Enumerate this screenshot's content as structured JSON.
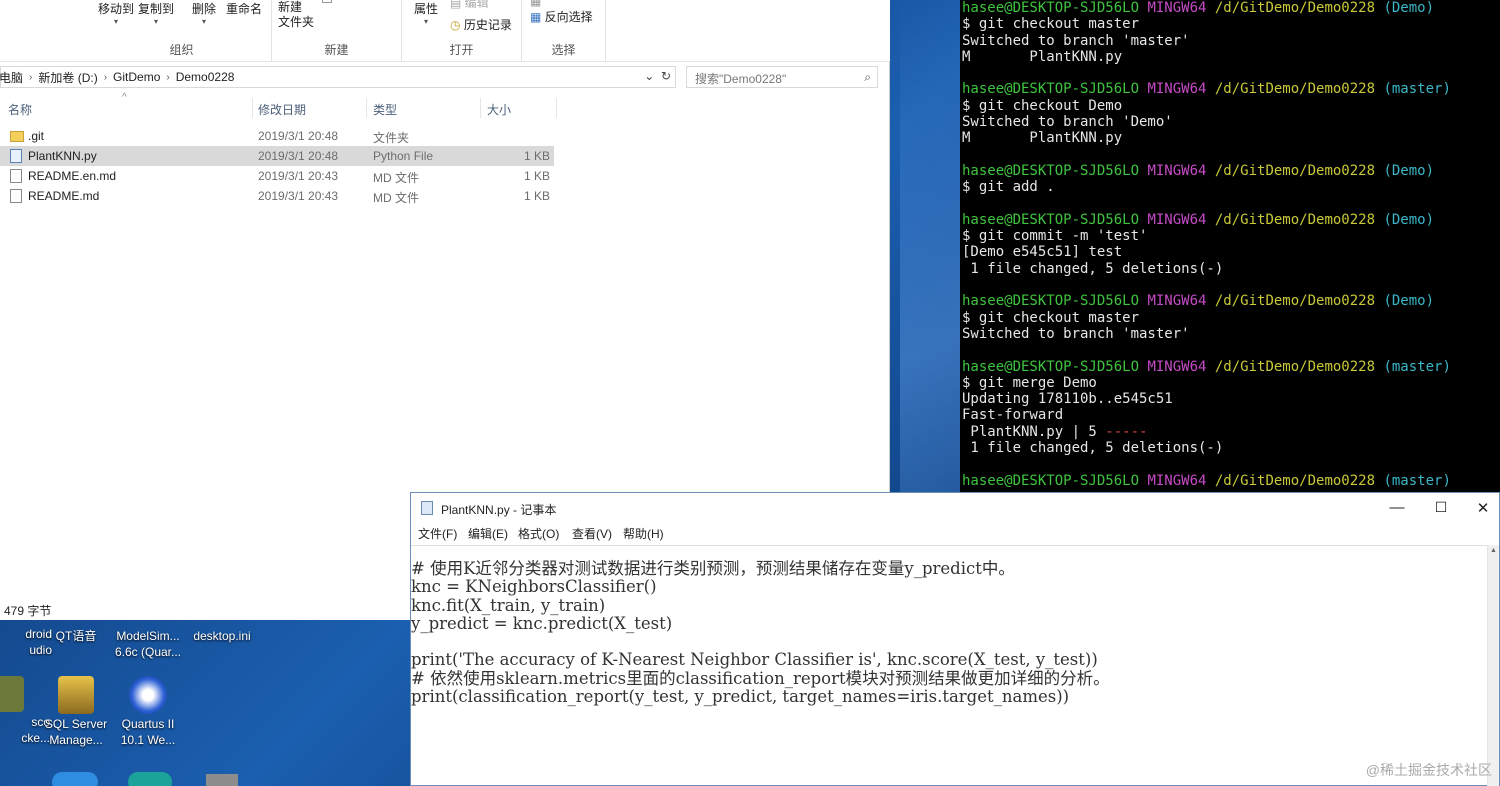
{
  "explorer": {
    "ribbon": {
      "groups": [
        {
          "label": "组织",
          "buttons": [
            "移动到",
            "复制到",
            "删除",
            "重命名"
          ]
        },
        {
          "label": "新建",
          "buttons": [
            "新建",
            "文件夹"
          ]
        },
        {
          "label": "打开",
          "buttons": [
            "属性",
            "编辑",
            "历史记录"
          ]
        },
        {
          "label": "选择",
          "buttons": [
            "反向选择"
          ]
        }
      ]
    },
    "address": {
      "segments": [
        "电脑",
        "新加卷 (D:)",
        "GitDemo",
        "Demo0228"
      ],
      "search_placeholder": "搜索\"Demo0228\""
    },
    "columns": [
      "名称",
      "修改日期",
      "类型",
      "大小"
    ],
    "files": [
      {
        "name": ".git",
        "date": "2019/3/1 20:48",
        "type": "文件夹",
        "size": "",
        "icon": "folder-icon",
        "selected": false
      },
      {
        "name": "PlantKNN.py",
        "date": "2019/3/1 20:48",
        "type": "Python File",
        "size": "1 KB",
        "icon": "python-file-icon",
        "selected": true
      },
      {
        "name": "README.en.md",
        "date": "2019/3/1 20:43",
        "type": "MD 文件",
        "size": "1 KB",
        "icon": "file-icon",
        "selected": false
      },
      {
        "name": "README.md",
        "date": "2019/3/1 20:43",
        "type": "MD 文件",
        "size": "1 KB",
        "icon": "file-icon",
        "selected": false
      }
    ],
    "status": "479 字节"
  },
  "desktop_icons": [
    {
      "label": "droid\nudio",
      "name": "android-studio-icon"
    },
    {
      "label": "QT语音",
      "name": "qt-voice-icon"
    },
    {
      "label": "ModelSim...\n6.6c (Quar...",
      "name": "modelsim-icon"
    },
    {
      "label": "desktop.ini",
      "name": "desktop-ini-icon"
    },
    {
      "label": "sco\ncke...",
      "name": "cisco-packet-icon"
    },
    {
      "label": "SQL Server\nManage...",
      "name": "sql-server-icon"
    },
    {
      "label": "Quartus II\n10.1 We...",
      "name": "quartus-icon"
    }
  ],
  "terminal": {
    "lines": [
      [
        {
          "t": "hasee@DESKTOP-SJD56LO ",
          "c": "green"
        },
        {
          "t": "MINGW64 ",
          "c": "purple"
        },
        {
          "t": "/d/GitDemo/Demo0228 ",
          "c": "yellow"
        },
        {
          "t": "(Demo)",
          "c": "cyan"
        }
      ],
      [
        {
          "t": "$ git checkout master",
          "c": "white"
        }
      ],
      [
        {
          "t": "Switched to branch 'master'",
          "c": "white"
        }
      ],
      [
        {
          "t": "M       PlantKNN.py",
          "c": "white"
        }
      ],
      [],
      [
        {
          "t": "hasee@DESKTOP-SJD56LO ",
          "c": "green"
        },
        {
          "t": "MINGW64 ",
          "c": "purple"
        },
        {
          "t": "/d/GitDemo/Demo0228 ",
          "c": "yellow"
        },
        {
          "t": "(master)",
          "c": "cyan"
        }
      ],
      [
        {
          "t": "$ git checkout Demo",
          "c": "white"
        }
      ],
      [
        {
          "t": "Switched to branch 'Demo'",
          "c": "white"
        }
      ],
      [
        {
          "t": "M       PlantKNN.py",
          "c": "white"
        }
      ],
      [],
      [
        {
          "t": "hasee@DESKTOP-SJD56LO ",
          "c": "green"
        },
        {
          "t": "MINGW64 ",
          "c": "purple"
        },
        {
          "t": "/d/GitDemo/Demo0228 ",
          "c": "yellow"
        },
        {
          "t": "(Demo)",
          "c": "cyan"
        }
      ],
      [
        {
          "t": "$ git add .",
          "c": "white"
        }
      ],
      [],
      [
        {
          "t": "hasee@DESKTOP-SJD56LO ",
          "c": "green"
        },
        {
          "t": "MINGW64 ",
          "c": "purple"
        },
        {
          "t": "/d/GitDemo/Demo0228 ",
          "c": "yellow"
        },
        {
          "t": "(Demo)",
          "c": "cyan"
        }
      ],
      [
        {
          "t": "$ git commit -m 'test'",
          "c": "white"
        }
      ],
      [
        {
          "t": "[Demo e545c51] test",
          "c": "white"
        }
      ],
      [
        {
          "t": " 1 file changed, 5 deletions(-)",
          "c": "white"
        }
      ],
      [],
      [
        {
          "t": "hasee@DESKTOP-SJD56LO ",
          "c": "green"
        },
        {
          "t": "MINGW64 ",
          "c": "purple"
        },
        {
          "t": "/d/GitDemo/Demo0228 ",
          "c": "yellow"
        },
        {
          "t": "(Demo)",
          "c": "cyan"
        }
      ],
      [
        {
          "t": "$ git checkout master",
          "c": "white"
        }
      ],
      [
        {
          "t": "Switched to branch 'master'",
          "c": "white"
        }
      ],
      [],
      [
        {
          "t": "hasee@DESKTOP-SJD56LO ",
          "c": "green"
        },
        {
          "t": "MINGW64 ",
          "c": "purple"
        },
        {
          "t": "/d/GitDemo/Demo0228 ",
          "c": "yellow"
        },
        {
          "t": "(master)",
          "c": "cyan"
        }
      ],
      [
        {
          "t": "$ git merge Demo",
          "c": "white"
        }
      ],
      [
        {
          "t": "Updating 178110b..e545c51",
          "c": "white"
        }
      ],
      [
        {
          "t": "Fast-forward",
          "c": "white"
        }
      ],
      [
        {
          "t": " PlantKNN.py | 5 ",
          "c": "white"
        },
        {
          "t": "-----",
          "c": "red"
        }
      ],
      [
        {
          "t": " 1 file changed, 5 deletions(-)",
          "c": "white"
        }
      ],
      [],
      [
        {
          "t": "hasee@DESKTOP-SJD56LO ",
          "c": "green"
        },
        {
          "t": "MINGW64 ",
          "c": "purple"
        },
        {
          "t": "/d/GitDemo/Demo0228 ",
          "c": "yellow"
        },
        {
          "t": "(master)",
          "c": "cyan"
        }
      ]
    ]
  },
  "notepad": {
    "title": "PlantKNN.py - 记事本",
    "menu": [
      "文件(F)",
      "编辑(E)",
      "格式(O)",
      "查看(V)",
      "帮助(H)"
    ],
    "lines": [
      "# 使用K近邻分类器对测试数据进行类别预测，预测结果储存在变量y_predict中。",
      "knc = KNeighborsClassifier()",
      "knc.fit(X_train, y_train)",
      "y_predict = knc.predict(X_test)",
      "",
      "print('The accuracy of K-Nearest Neighbor Classifier is', knc.score(X_test, y_test))",
      "# 依然使用sklearn.metrics里面的classification_report模块对预测结果做更加详细的分析。",
      "print(classification_report(y_test, y_predict, target_names=iris.target_names))"
    ]
  },
  "watermark": "@稀土掘金技术社区",
  "colors": {
    "green": "#3fc43f",
    "purple": "#c64bc6",
    "yellow": "#c8c838",
    "cyan": "#3bb7c8",
    "red": "#d84a4a",
    "white": "#e6e6e6"
  }
}
